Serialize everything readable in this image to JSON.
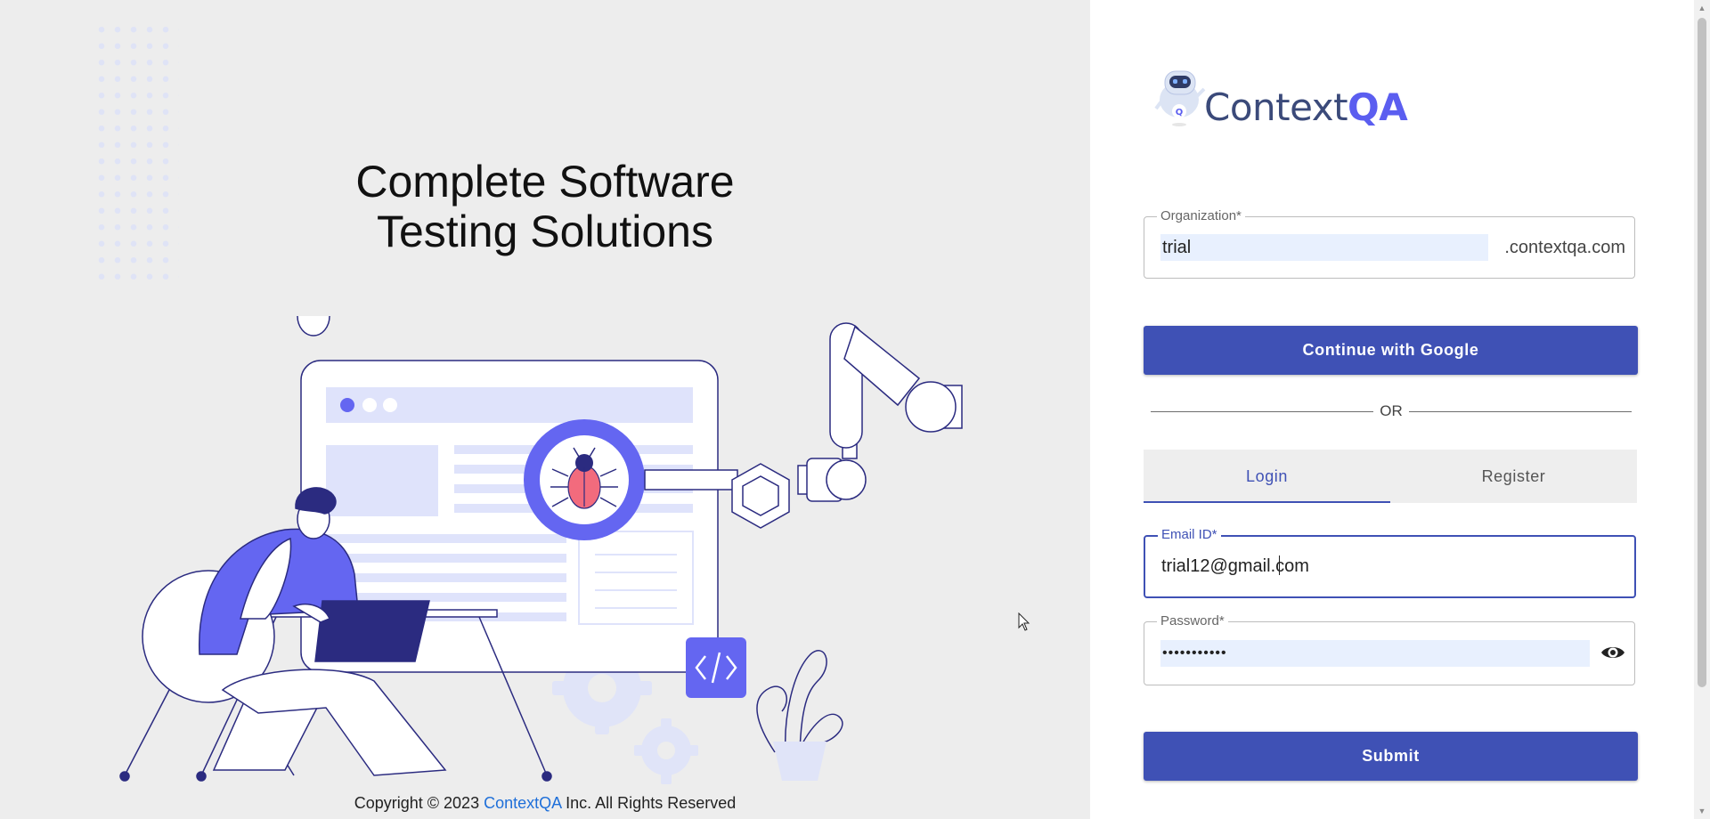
{
  "headline": {
    "line1": "Complete Software",
    "line2": "Testing Solutions"
  },
  "footer": {
    "prefix": "Copyright © 2023",
    "brand": "ContextQA",
    "suffix": "Inc. All Rights Reserved"
  },
  "logo": {
    "text_part1": "Context",
    "text_part2": "QA",
    "icon": "robot-icon"
  },
  "form": {
    "organization": {
      "label": "Organization*",
      "value": "trial",
      "suffix": ".contextqa.com"
    },
    "google_button": "Continue with Google",
    "or_text": "OR",
    "tabs": [
      {
        "label": "Login",
        "active": true
      },
      {
        "label": "Register",
        "active": false
      }
    ],
    "email": {
      "label": "Email ID*",
      "value": "trial12@gmail.com"
    },
    "password": {
      "label": "Password*",
      "value": "•••••••••••",
      "toggle_icon": "eye-icon"
    },
    "submit_button": "Submit"
  },
  "colors": {
    "primary": "#3f51b5",
    "illustration_accent": "#6466f1",
    "illustration_light": "#dfe3fb",
    "illustration_outline": "#2b2b80",
    "bug": "#f26b7d",
    "left_background": "#ededed",
    "copyright_link": "#1e6fd9"
  }
}
